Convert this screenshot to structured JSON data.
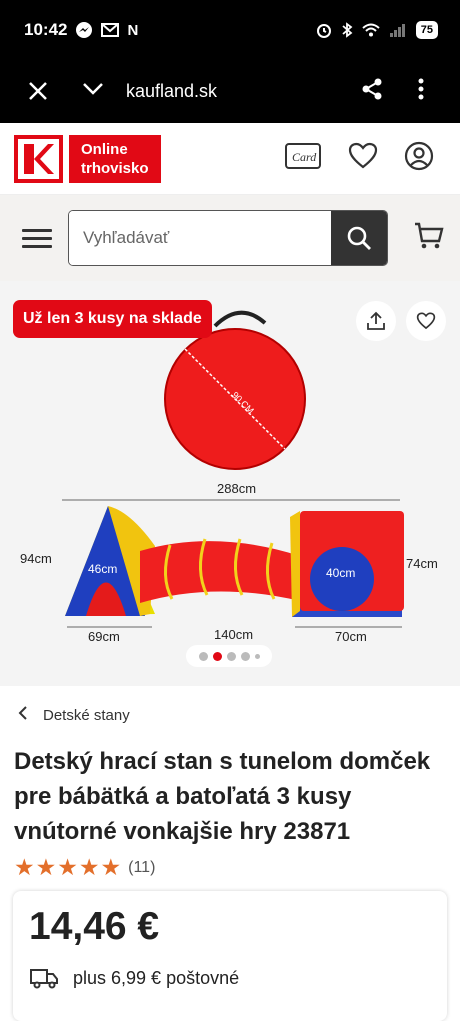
{
  "statusbar": {
    "time": "10:42",
    "left_icons": [
      "messenger-icon",
      "gmail-icon",
      "n-icon"
    ],
    "battery": "75"
  },
  "browser": {
    "url": "kaufland.sk"
  },
  "header": {
    "logo_line1": "Online",
    "logo_line2": "trhovisko",
    "card_label": "Card"
  },
  "search": {
    "placeholder": "Vyhľadávať"
  },
  "gallery": {
    "stock_badge": "Už len 3 kusy na sklade",
    "dim_labels": {
      "diameter": "90 CM",
      "total": "288cm",
      "left_height": "94cm",
      "left_width": "46cm",
      "right_width": "40cm",
      "right_height": "74cm",
      "bottom_left": "69cm",
      "bottom_mid": "140cm",
      "bottom_right": "70cm"
    },
    "dots": 5,
    "active_dot": 1
  },
  "breadcrumb": {
    "label": "Detské stany"
  },
  "product": {
    "title": "Detský hrací stan s tunelom domček pre bábätká a batoľatá 3 kusy vnútorné vonkajšie hry 23871",
    "rating_stars": 5,
    "rating_count": "(11)",
    "price": "14,46 €",
    "shipping": "plus 6,99 € poštovné"
  },
  "colors": {
    "brand_red": "#e10915",
    "star": "#e36f2b",
    "dark": "#333333"
  }
}
